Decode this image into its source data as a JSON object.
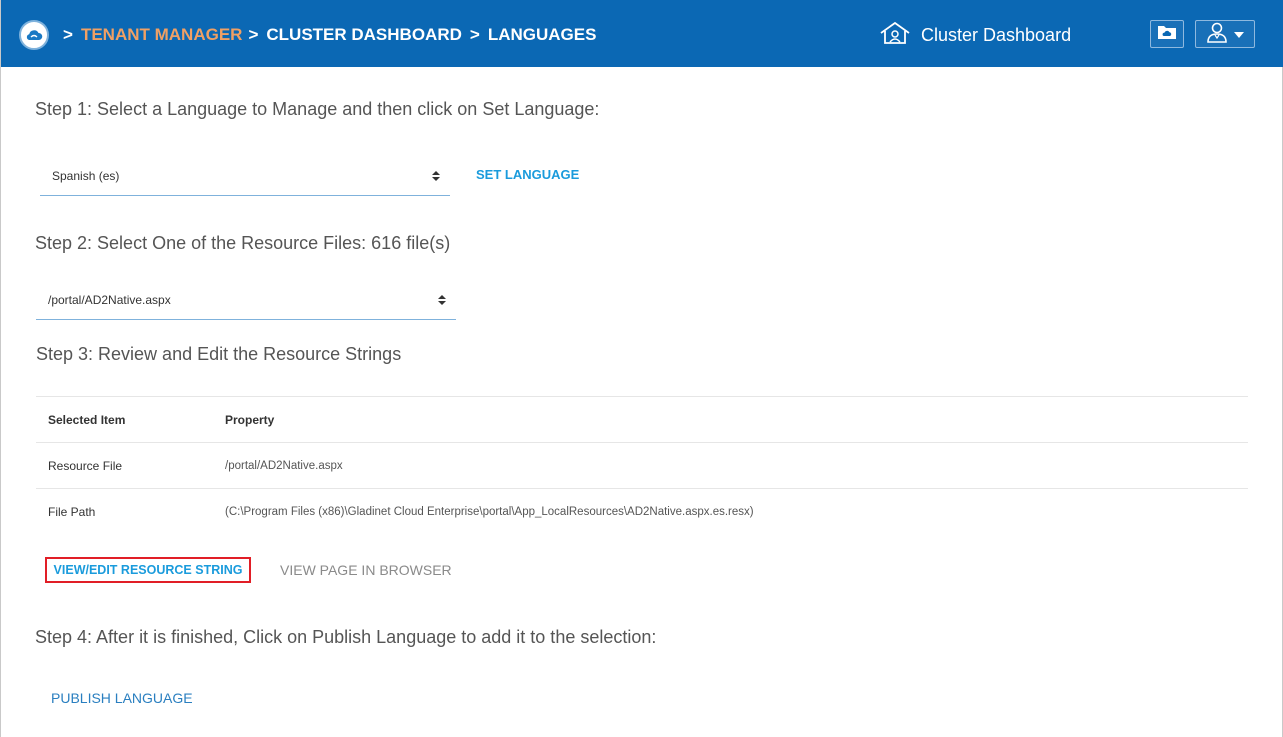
{
  "header": {
    "breadcrumb": {
      "sep1": ">",
      "tenant_manager": "TENANT MANAGER",
      "sep2": ">",
      "cluster_dashboard": "CLUSTER DASHBOARD",
      "sep3": ">",
      "current": "LANGUAGES"
    },
    "cluster_dashboard_link": "Cluster Dashboard",
    "icons": {
      "logo": "cloud-logo-icon",
      "house": "house-user-icon",
      "folder": "cloud-folder-icon",
      "user": "user-icon",
      "dropdown": "caret-down-icon"
    },
    "colors": {
      "bar": "#0b68b4",
      "accent_orange": "#f0a064"
    }
  },
  "step1": {
    "label": "Step 1: Select a Language to Manage and then click on Set Language:",
    "language_select_value": "Spanish (es)",
    "set_language_button": "SET LANGUAGE"
  },
  "step2": {
    "label": "Step 2: Select One of the Resource Files: 616 file(s)",
    "file_select_value": "/portal/AD2Native.aspx"
  },
  "step3": {
    "label": "Step 3: Review and Edit the Resource Strings",
    "table": {
      "headers": [
        "Selected Item",
        "Property"
      ],
      "rows": [
        [
          "Resource File",
          "/portal/AD2Native.aspx"
        ],
        [
          "File Path",
          "(C:\\Program Files (x86)\\Gladinet Cloud Enterprise\\portal\\App_LocalResources\\AD2Native.aspx.es.resx)"
        ]
      ]
    },
    "view_edit_button": "VIEW/EDIT RESOURCE STRING",
    "view_in_browser_button": "VIEW PAGE IN BROWSER"
  },
  "step4": {
    "label": "Step 4: After it is finished, Click on Publish Language to add it to the selection:",
    "publish_button": "PUBLISH LANGUAGE"
  }
}
